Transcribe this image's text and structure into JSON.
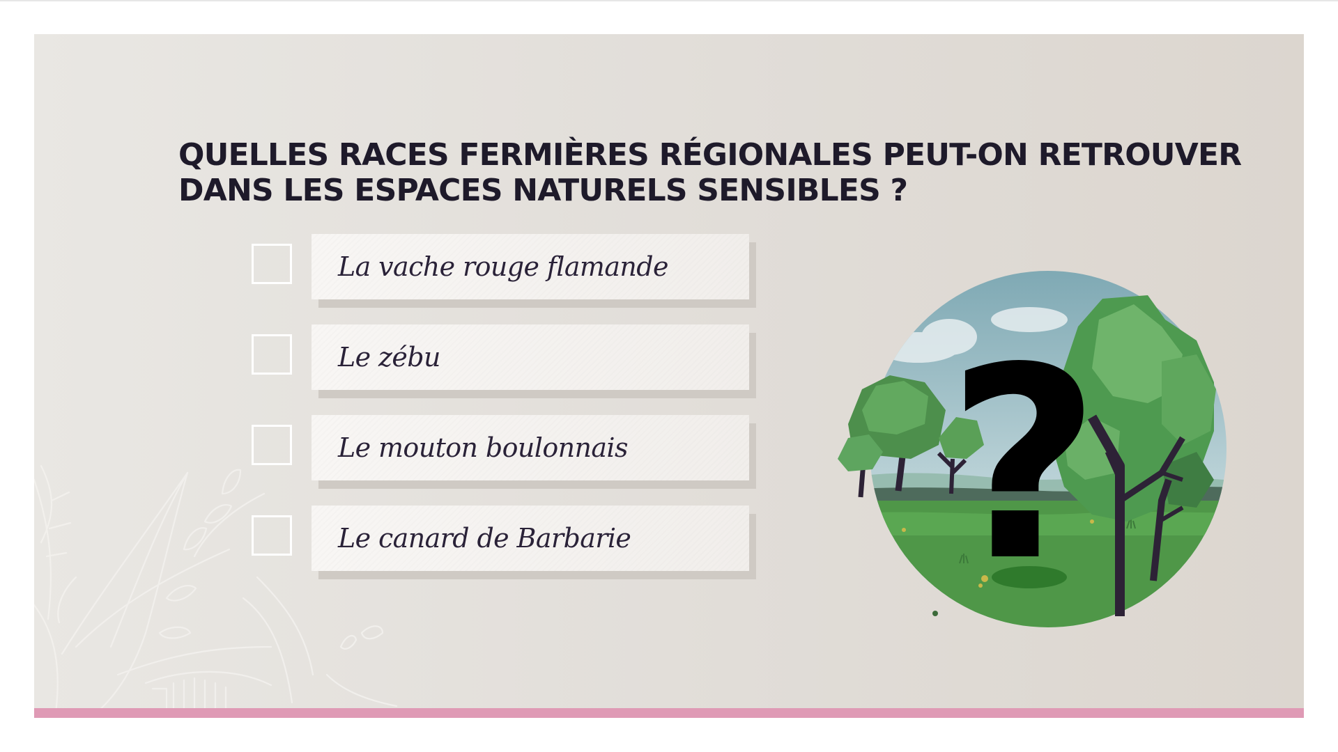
{
  "quiz": {
    "question_line_1": "QUELLES RACES FERMIÈRES RÉGIONALES PEUT-ON RETROUVER",
    "question_line_2": "DANS LES ESPACES NATURELS SENSIBLES ?",
    "answers": [
      {
        "label": "La vache rouge flamande",
        "checked": false
      },
      {
        "label": "Le zébu",
        "checked": false
      },
      {
        "label": "Le mouton boulonnais",
        "checked": false
      },
      {
        "label": "Le canard de Barbarie",
        "checked": false
      }
    ]
  },
  "illustration": {
    "symbol": "?",
    "icon": "question-mark-landscape-icon"
  },
  "colors": {
    "background": "#e4e0db",
    "title_text": "#1e1a2a",
    "answer_text": "#2a2238",
    "accent_bar": "#df9ab5",
    "tree_green": "#5ea55f",
    "sky": "#9bbcc6"
  }
}
